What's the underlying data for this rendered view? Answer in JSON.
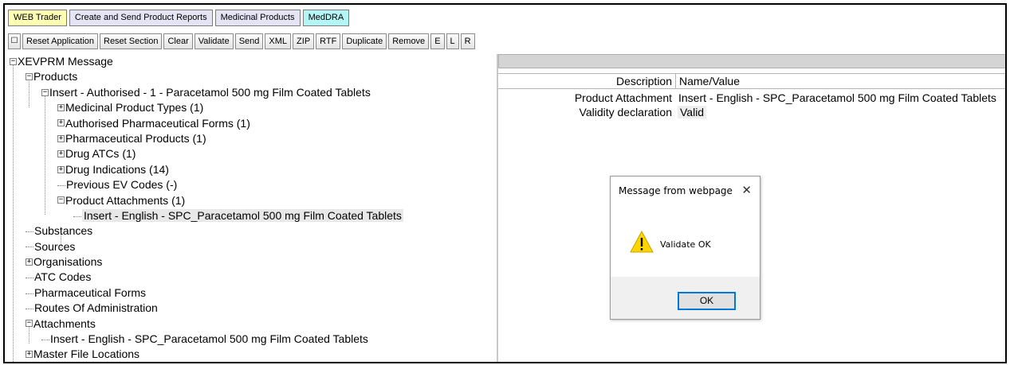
{
  "tabs": [
    "WEB Trader",
    "Create and Send Product Reports",
    "Medicinal Products",
    "MedDRA"
  ],
  "toolbar": {
    "icon_button": "☐",
    "buttons": [
      "Reset Application",
      "Reset Section",
      "Clear",
      "Validate",
      "Send",
      "XML",
      "ZIP",
      "RTF",
      "Duplicate",
      "Remove",
      "E",
      "L",
      "R"
    ]
  },
  "tree": {
    "root": "XEVPRM Message",
    "products": "Products",
    "product_insert": "Insert - Authorised - 1 - Paracetamol 500 mg Film Coated Tablets",
    "medicinal_product_types": "Medicinal Product Types (1)",
    "authorised_pharma_forms": "Authorised Pharmaceutical Forms (1)",
    "pharmaceutical_products": "Pharmaceutical Products (1)",
    "drug_atcs": "Drug ATCs (1)",
    "drug_indications": "Drug Indications (14)",
    "previous_ev_codes": "Previous EV Codes (-)",
    "product_attachments": "Product Attachments (1)",
    "product_attachment_item": "Insert - English - SPC_Paracetamol 500 mg Film Coated Tablets",
    "substances": "Substances",
    "sources": "Sources",
    "organisations": "Organisations",
    "atc_codes": "ATC Codes",
    "pharmaceutical_forms": "Pharmaceutical Forms",
    "routes_of_administration": "Routes Of Administration",
    "attachments": "Attachments",
    "attachment_item": "Insert - English - SPC_Paracetamol 500 mg Film Coated Tablets",
    "master_file_locations": "Master File Locations"
  },
  "details": {
    "header_description": "Description",
    "header_value": "Name/Value",
    "rows": [
      {
        "description": "Product Attachment",
        "value": "Insert - English - SPC_Paracetamol 500 mg Film Coated Tablets"
      },
      {
        "description": "Validity declaration",
        "value": "Valid"
      }
    ]
  },
  "dialog": {
    "title": "Message from webpage",
    "close": "✕",
    "message": "Validate OK",
    "ok_label": "OK"
  },
  "colors": {
    "tab_web_trader": "#ffffb4",
    "tab_meddra": "#b4f5f5",
    "ok_border": "#0078d7"
  }
}
